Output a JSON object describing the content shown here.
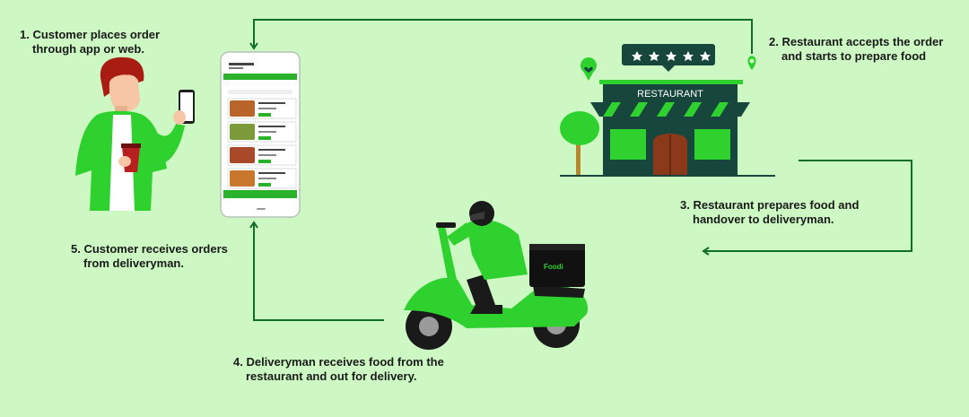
{
  "steps": {
    "s1": {
      "line1": "1. Customer places order",
      "line2": "through app or web."
    },
    "s2": {
      "line1": "2. Restaurant accepts the order",
      "line2": "and starts to prepare food"
    },
    "s3": {
      "line1": "3. Restaurant prepares food and",
      "line2": "handover to deliveryman."
    },
    "s4": {
      "line1": "4. Deliveryman receives food from the",
      "line2": "restaurant and out for delivery."
    },
    "s5": {
      "line1": "5. Customer receives orders",
      "line2": "from deliveryman."
    }
  },
  "restaurant": {
    "sign": "RESTAURANT"
  },
  "delivery_box": {
    "logo": "Foodi"
  },
  "colors": {
    "background": "#cdf8c4",
    "arrow": "#0f6f2a",
    "brand_green": "#2fd12f",
    "dark_teal": "#17463c"
  }
}
